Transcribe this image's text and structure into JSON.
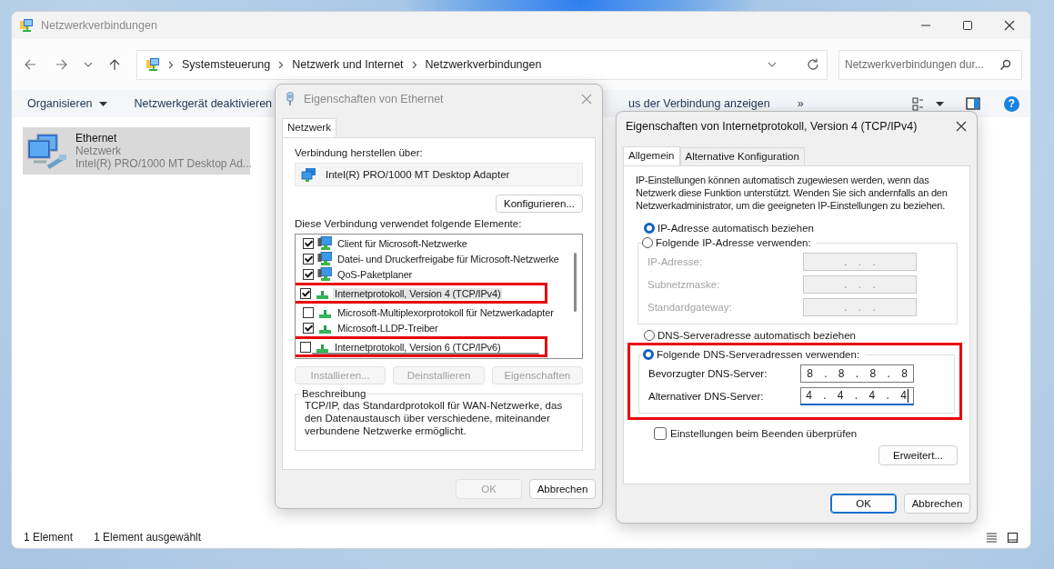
{
  "explorer": {
    "title": "Netzwerkverbindungen",
    "active": false,
    "breadcrumb": [
      "Systemsteuerung",
      "Netzwerk und Internet",
      "Netzwerkverbindungen"
    ],
    "search": {
      "placeholder": "Netzwerkverbindungen dur..."
    },
    "commands": [
      {
        "label": "Organisieren",
        "dropdown": true
      },
      {
        "label": "Netzwerkgerät deaktivieren",
        "dropdown": false
      },
      {
        "label": "us der Verbindung anzeigen",
        "dropdown": false
      },
      {
        "label": "»",
        "dropdown": false
      }
    ],
    "help": "?",
    "items": [
      {
        "name": "Ethernet",
        "type": "Netzwerk",
        "device": "Intel(R) PRO/1000 MT Desktop Ad...",
        "selected": true
      }
    ],
    "status_bar": [
      "1 Element",
      "1 Element ausgewählt"
    ]
  },
  "ethernet_dialog": {
    "title": "Eigenschaften von Ethernet",
    "active": false,
    "tabs": [
      {
        "label": "Netzwerk",
        "selected": true
      }
    ],
    "connect_label": "Verbindung herstellen über:",
    "adapter": "Intel(R) PRO/1000 MT Desktop Adapter",
    "configure_button": "Konfigurieren...",
    "elements_label": "Diese Verbindung verwendet folgende Elemente:",
    "elements": [
      {
        "label": "Client für Microsoft-Netzwerke",
        "kind": "service",
        "checked": true,
        "selected": false,
        "highlighted": false
      },
      {
        "label": "Datei- und Druckerfreigabe für Microsoft-Netzwerke",
        "kind": "service",
        "checked": true,
        "selected": false,
        "highlighted": false
      },
      {
        "label": "QoS-Paketplaner",
        "kind": "service",
        "checked": true,
        "selected": false,
        "highlighted": false
      },
      {
        "label": "Internetprotokoll, Version 4 (TCP/IPv4)",
        "kind": "protocol",
        "checked": true,
        "selected": true,
        "highlighted": true
      },
      {
        "label": "Microsoft-Multiplexorprotokoll für Netzwerkadapter",
        "kind": "protocol",
        "checked": false,
        "selected": false,
        "highlighted": false
      },
      {
        "label": "Microsoft-LLDP-Treiber",
        "kind": "protocol",
        "checked": true,
        "selected": false,
        "highlighted": false
      },
      {
        "label": "Internetprotokoll, Version 6 (TCP/IPv6)",
        "kind": "protocol",
        "checked": false,
        "selected": false,
        "highlighted": true
      }
    ],
    "action_buttons": [
      {
        "label": "Installieren...",
        "disabled": true
      },
      {
        "label": "Deinstallieren",
        "disabled": true
      },
      {
        "label": "Eigenschaften",
        "disabled": true
      }
    ],
    "description": {
      "title": "Beschreibung",
      "text": "TCP/IP, das Standardprotokoll für WAN-Netzwerke, das den Datenaustausch über verschiedene, miteinander verbundene Netzwerke ermöglicht."
    },
    "buttons": [
      {
        "label": "OK",
        "disabled": true,
        "default": false
      },
      {
        "label": "Abbrechen",
        "disabled": false,
        "default": false
      }
    ]
  },
  "ipv4_dialog": {
    "title": "Eigenschaften von Internetprotokoll, Version 4 (TCP/IPv4)",
    "active": true,
    "tabs": [
      {
        "label": "Allgemein",
        "selected": true
      },
      {
        "label": "Alternative Konfiguration",
        "selected": false
      }
    ],
    "intro": "IP-Einstellungen können automatisch zugewiesen werden, wenn das Netzwerk diese Funktion unterstützt. Wenden Sie sich andernfalls an den Netzwerkadministrator, um die geeigneten IP-Einstellungen zu beziehen.",
    "ip_options": [
      {
        "label": "IP-Adresse automatisch beziehen",
        "selected": true
      },
      {
        "label": "Folgende IP-Adresse verwenden:",
        "selected": false
      }
    ],
    "ip_fields": [
      {
        "label": "IP-Adresse:",
        "value": ". . .",
        "disabled": true,
        "focused": false
      },
      {
        "label": "Subnetzmaske:",
        "value": ". . .",
        "disabled": true,
        "focused": false
      },
      {
        "label": "Standardgateway:",
        "value": ". . .",
        "disabled": true,
        "focused": false
      }
    ],
    "dns_options": [
      {
        "label": "DNS-Serveradresse automatisch beziehen",
        "selected": false
      },
      {
        "label": "Folgende DNS-Serveradressen verwenden:",
        "selected": true
      }
    ],
    "dns_highlighted": true,
    "dns_fields": [
      {
        "label": "Bevorzugter DNS-Server:",
        "value": "8 . 8 . 8 . 8",
        "disabled": false,
        "focused": false
      },
      {
        "label": "Alternativer DNS-Server:",
        "value": "4 . 4 . 4 . 4",
        "disabled": false,
        "focused": true
      }
    ],
    "validate": {
      "label": "Einstellungen beim Beenden überprüfen",
      "checked": false
    },
    "advanced_button": "Erweitert...",
    "buttons": [
      {
        "label": "OK",
        "disabled": false,
        "default": true
      },
      {
        "label": "Abbrechen",
        "disabled": false,
        "default": false
      }
    ]
  }
}
